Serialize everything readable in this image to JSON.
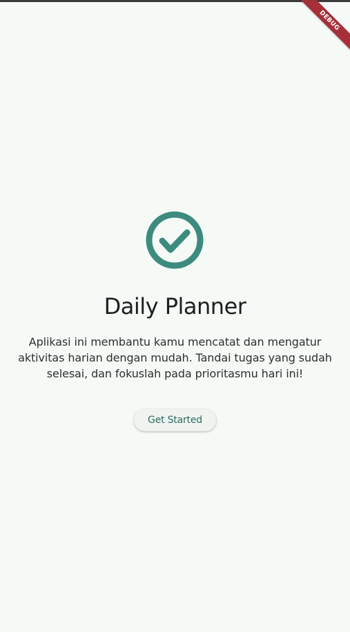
{
  "debug_banner": "DEBUG",
  "colors": {
    "background": "#f5faf7",
    "accent": "#3d8b7e",
    "banner": "#a5303a"
  },
  "icon": {
    "name": "check-circle-icon"
  },
  "hero": {
    "title": "Daily Planner",
    "description": "Aplikasi ini membantu kamu mencatat dan mengatur aktivitas harian dengan mudah. Tandai tugas yang sudah selesai, dan fokuslah pada prioritasmu hari ini!"
  },
  "actions": {
    "get_started_label": "Get Started"
  }
}
